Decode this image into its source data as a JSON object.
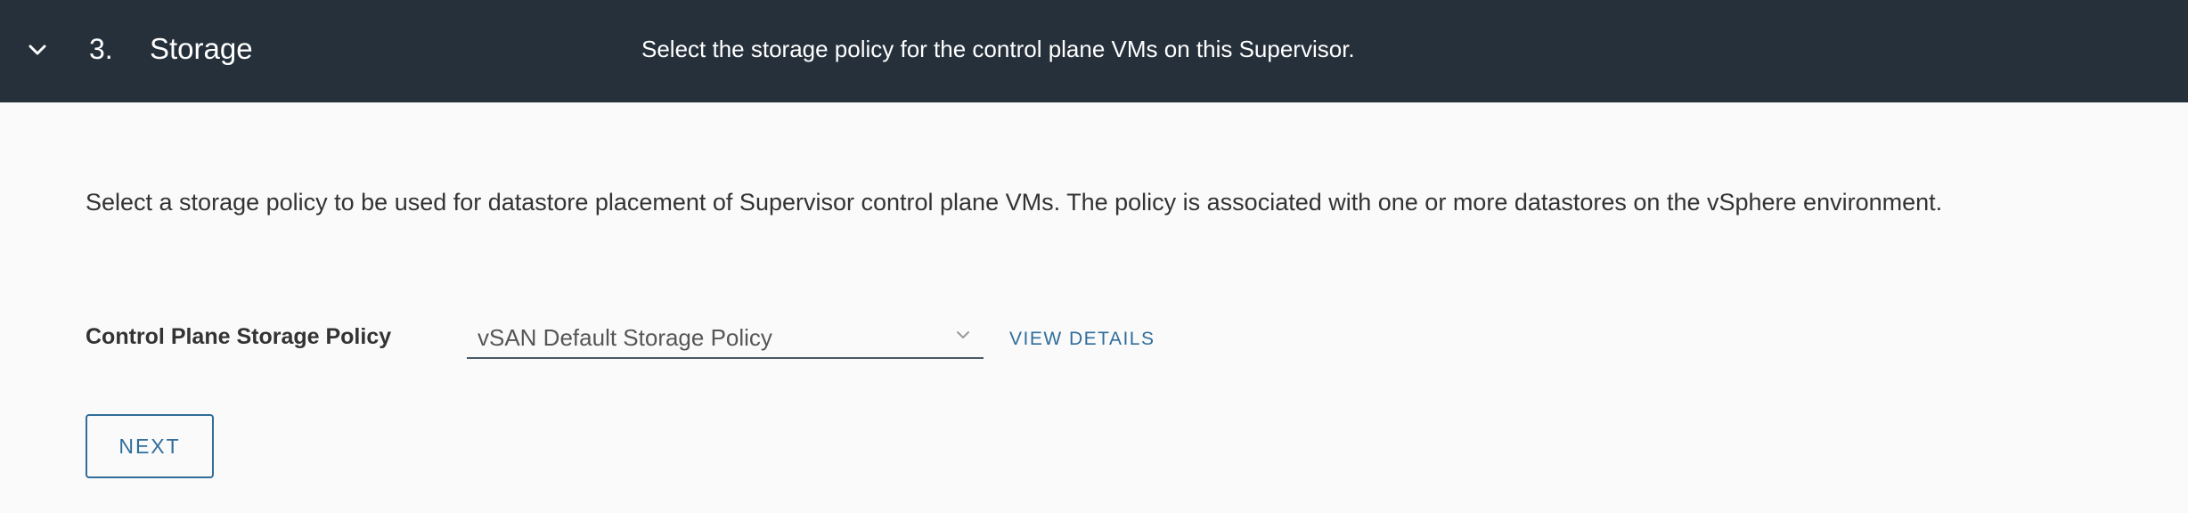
{
  "header": {
    "chevron_icon": "chevron-down-icon",
    "step_number": "3.",
    "step_title": "Storage",
    "step_description": "Select the storage policy for the control plane VMs on this Supervisor."
  },
  "main": {
    "intro_text": "Select a storage policy to be used for datastore placement of Supervisor control plane VMs. The policy is associated with one or more datastores on the vSphere environment.",
    "storage_policy": {
      "label": "Control Plane Storage Policy",
      "selected_value": "vSAN Default Storage Policy",
      "caret_icon": "chevron-down-icon"
    },
    "view_details_label": "VIEW DETAILS",
    "next_label": "NEXT"
  },
  "colors": {
    "header_background": "#25303b",
    "page_background": "#fafafa",
    "link_accent": "#2f6d9b",
    "body_text": "#333333"
  }
}
